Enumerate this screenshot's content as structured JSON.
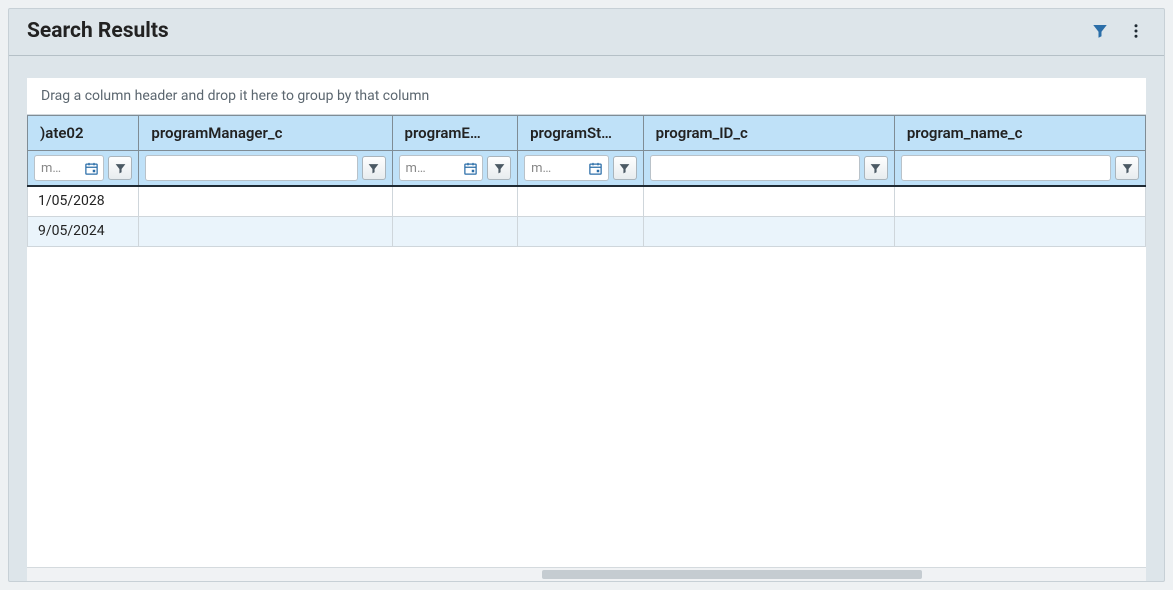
{
  "panel": {
    "title": "Search Results"
  },
  "grid": {
    "group_hint": "Drag a column header and drop it here to group by that column",
    "columns": {
      "date02": {
        "label": ")ate02"
      },
      "programManager": {
        "label": "programManager_c"
      },
      "programE": {
        "label": "programE…"
      },
      "programSt": {
        "label": "programSt…"
      },
      "programId": {
        "label": "program_ID_c"
      },
      "programName": {
        "label": "program_name_c"
      }
    },
    "filter_placeholder_date": "m…",
    "rows": [
      {
        "date02": "1/05/2028",
        "programManager": "",
        "programE": "",
        "programSt": "",
        "programId": "",
        "programName": ""
      },
      {
        "date02": "9/05/2024",
        "programManager": "",
        "programE": "",
        "programSt": "",
        "programId": "",
        "programName": ""
      }
    ]
  }
}
